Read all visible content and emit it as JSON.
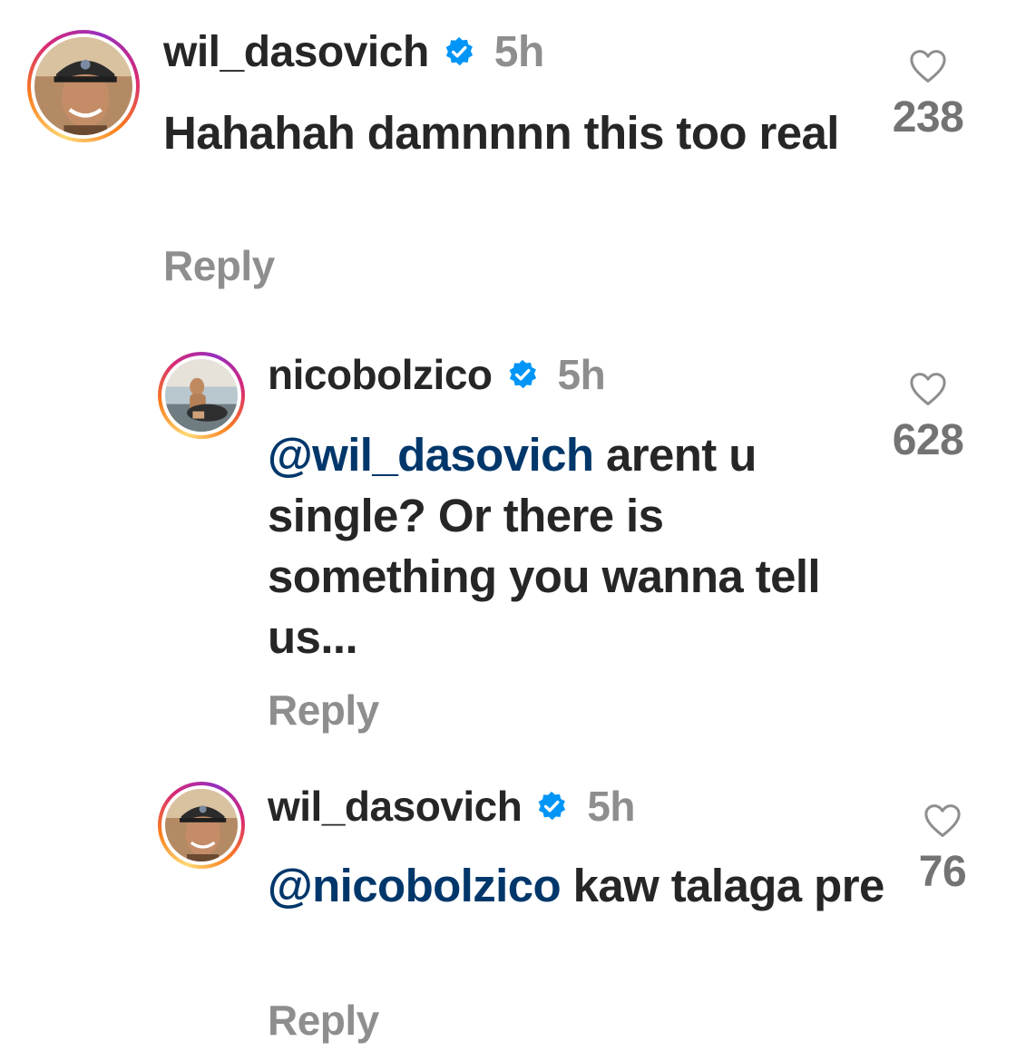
{
  "comments": [
    {
      "username": "wil_dasovich",
      "verified": true,
      "time": "5h",
      "mention": "",
      "text": "Hahahah damnnnn this too real",
      "reply_label": "Reply",
      "likes": "238",
      "avatar_icon": "profile-photo-icon"
    },
    {
      "username": "nicobolzico",
      "verified": true,
      "time": "5h",
      "mention": "@wil_dasovich",
      "text": "arent u single? Or there is something you wanna tell us...",
      "reply_label": "Reply",
      "likes": "628",
      "avatar_icon": "profile-photo-icon"
    },
    {
      "username": "wil_dasovich",
      "verified": true,
      "time": "5h",
      "mention": "@nicobolzico",
      "text": "kaw talaga pre",
      "reply_label": "Reply",
      "likes": "76",
      "avatar_icon": "profile-photo-icon"
    }
  ],
  "colors": {
    "text": "#262626",
    "secondary": "#8e8e8e",
    "mention": "#00376b",
    "verified": "#0095f6"
  }
}
